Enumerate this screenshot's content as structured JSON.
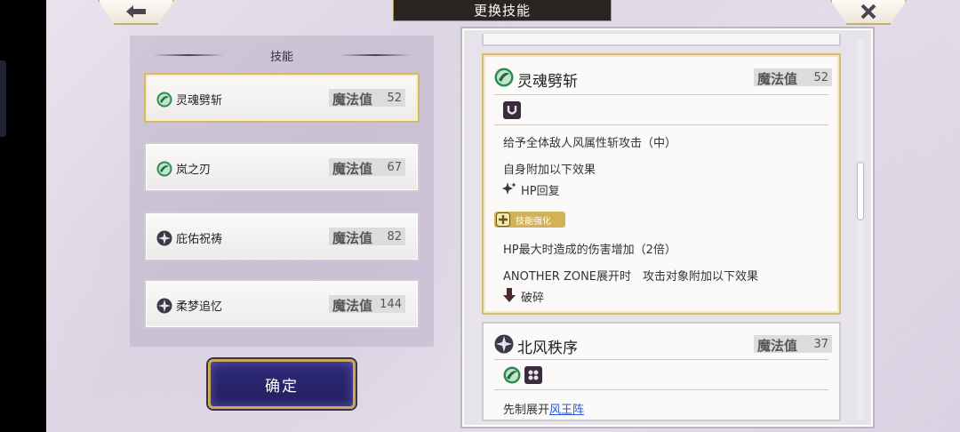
{
  "header": {
    "title": "更换技能",
    "back_icon": "back-arrow-icon",
    "close_icon": "close-icon"
  },
  "skill_list": {
    "title": "技能",
    "items": [
      {
        "name": "灵魂劈斩",
        "mp_label": "魔法值",
        "mp": "52",
        "icon": "wind-icon",
        "selected": true
      },
      {
        "name": "岚之刃",
        "mp_label": "魔法值",
        "mp": "67",
        "icon": "wind-icon",
        "selected": false
      },
      {
        "name": "庇佑祝祷",
        "mp_label": "魔法值",
        "mp": "82",
        "icon": "support-icon",
        "selected": false
      },
      {
        "name": "柔梦追忆",
        "mp_label": "魔法值",
        "mp": "144",
        "icon": "support-icon",
        "selected": false
      }
    ]
  },
  "confirm_button": {
    "label": "确定"
  },
  "detail": {
    "skill1": {
      "name": "灵魂劈斩",
      "mp_label": "魔法值",
      "mp": "52",
      "desc1": "给予全体敌人风属性斩攻击（中）",
      "desc2": "自身附加以下效果",
      "buff": "HP回复",
      "enhance_tag": "技能强化",
      "enh1": "HP最大时造成的伤害增加（2倍）",
      "enh2": "ANOTHER ZONE展开时　攻击对象附加以下效果",
      "debuff": "破碎"
    },
    "skill2": {
      "name": "北风秩序",
      "mp_label": "魔法值",
      "mp": "37",
      "desc_prefix": "先制展开",
      "desc_link": "风王阵"
    }
  },
  "colors": {
    "selected_border": "#d9bc6c",
    "confirm_bg": "#2e2a78",
    "wind_icon": "#2e8a55",
    "link": "#2a55d9"
  }
}
